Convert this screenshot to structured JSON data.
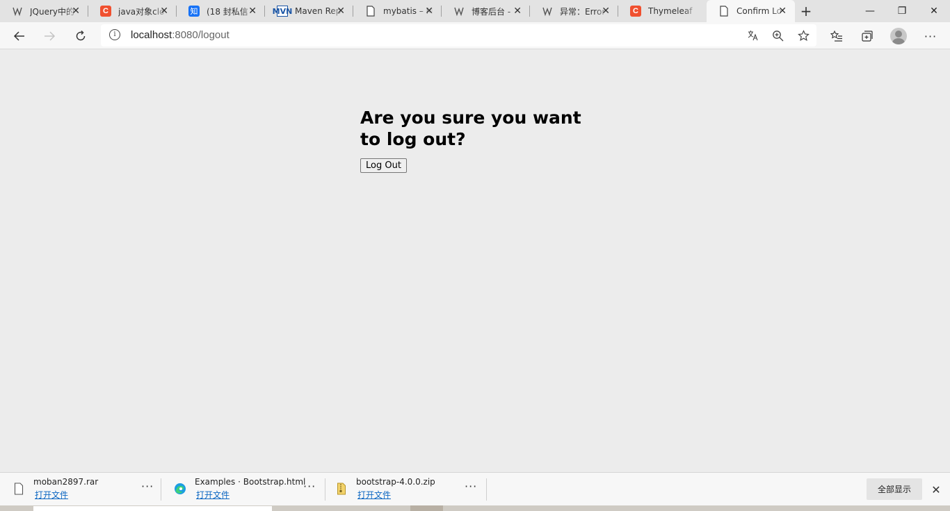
{
  "tabs": [
    {
      "title": "JQuery中的",
      "favicon": "blog-icon"
    },
    {
      "title": "java对象clo",
      "favicon": "csdn-icon"
    },
    {
      "title": "(18 封私信",
      "favicon": "zhihu-icon"
    },
    {
      "title": "Maven Rep",
      "favicon": "mvn-icon"
    },
    {
      "title": "mybatis – M",
      "favicon": "page-icon"
    },
    {
      "title": "博客后台 -",
      "favicon": "blog-icon"
    },
    {
      "title": "异常：Error",
      "favicon": "blog-icon"
    },
    {
      "title": "Thymeleaf",
      "favicon": "csdn-icon"
    },
    {
      "title": "Confirm Lo",
      "favicon": "page-icon",
      "active": true
    }
  ],
  "address": {
    "host": "localhost",
    "rest": ":8080/logout"
  },
  "page": {
    "heading": "Are you sure you want to log out?",
    "button_label": "Log Out"
  },
  "downloads": [
    {
      "name": "moban2897.rar",
      "action": "打开文件",
      "icon": "file-icon"
    },
    {
      "name": "Examples · Bootstrap.html",
      "action": "打开文件",
      "icon": "edge-icon"
    },
    {
      "name": "bootstrap-4.0.0.zip",
      "action": "打开文件",
      "icon": "zip-icon"
    }
  ],
  "downloads_bar": {
    "show_all": "全部显示"
  },
  "favicon_glyphs": {
    "csdn": "C",
    "zhihu": "知",
    "mvn": "MVN"
  }
}
